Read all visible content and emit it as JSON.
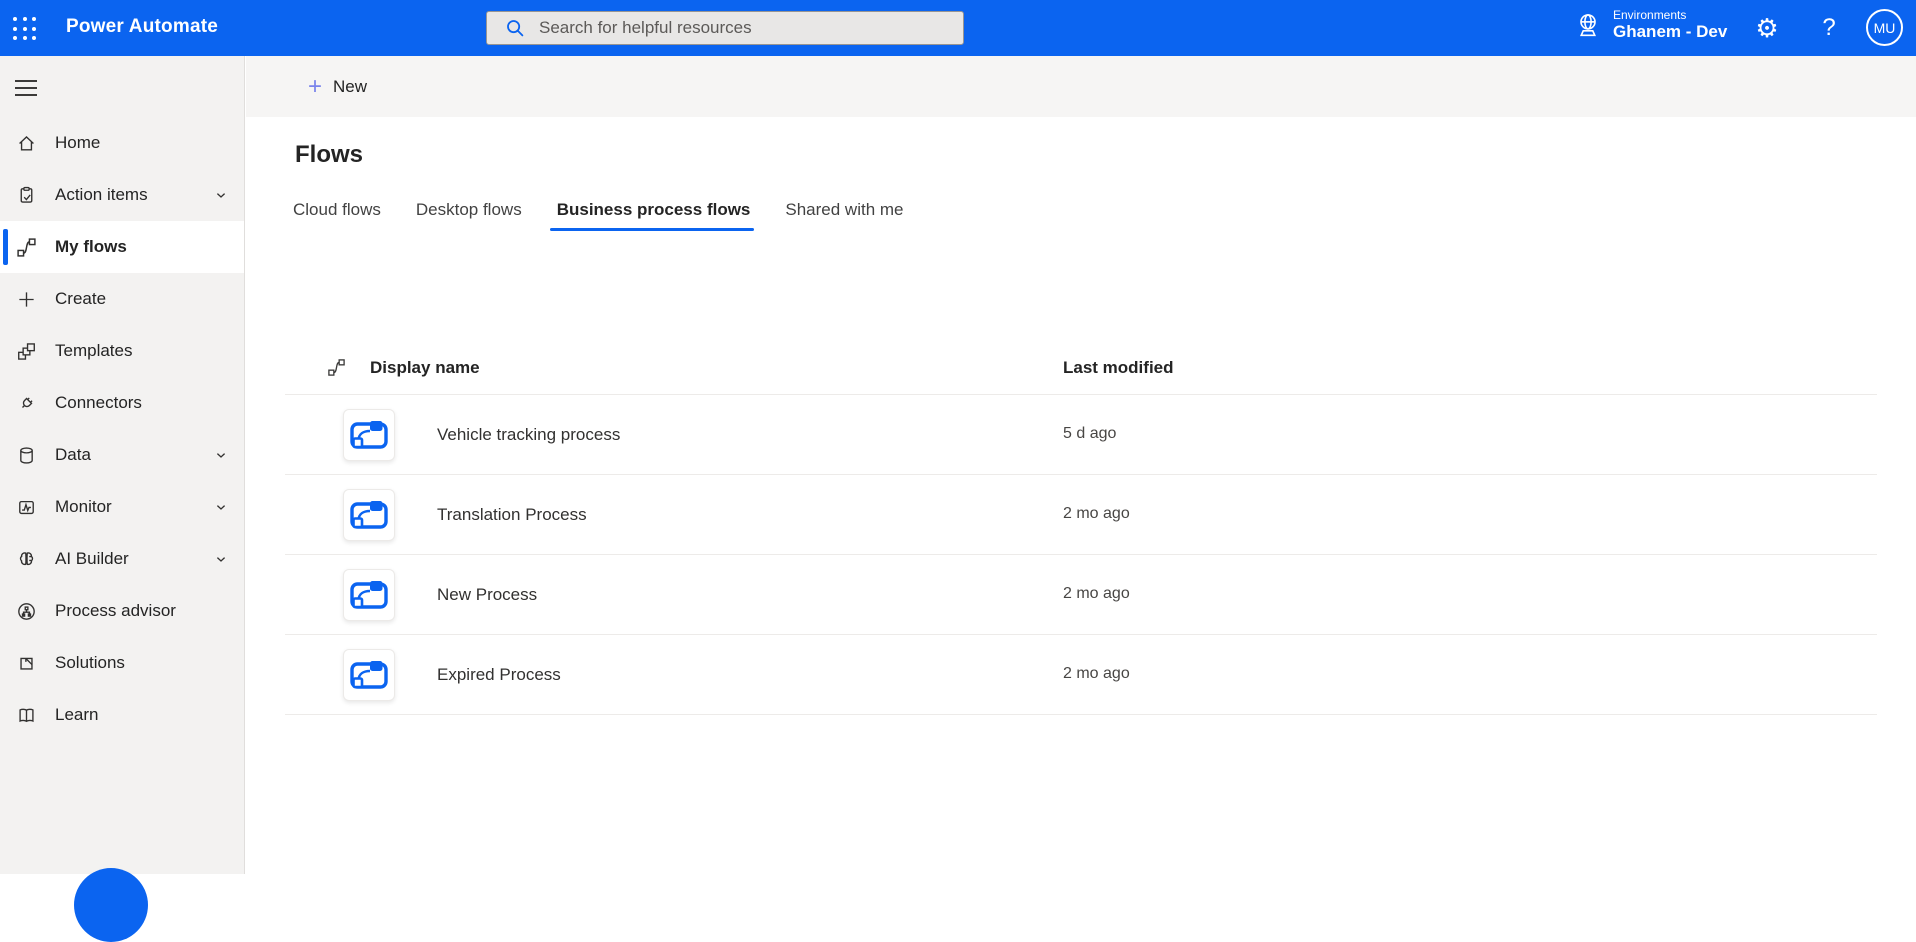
{
  "colors": {
    "accent": "#0B64F0",
    "header_bg": "#0B64F0",
    "sidebar_bg": "#F3F2F1"
  },
  "header": {
    "app_title": "Power Automate",
    "search_placeholder": "Search for helpful resources",
    "environments_label": "Environments",
    "environment_name": "Ghanem - Dev",
    "help_label": "?",
    "avatar_initials": "MU"
  },
  "command_bar": {
    "new_label": "New",
    "new_plus": "+"
  },
  "sidebar": {
    "items": [
      {
        "label": "Home",
        "icon": "home-icon"
      },
      {
        "label": "Action items",
        "icon": "action-items-icon",
        "chevron": true
      },
      {
        "label": "My flows",
        "icon": "my-flows-icon",
        "selected": true
      },
      {
        "label": "Create",
        "icon": "create-icon"
      },
      {
        "label": "Templates",
        "icon": "templates-icon"
      },
      {
        "label": "Connectors",
        "icon": "connectors-icon"
      },
      {
        "label": "Data",
        "icon": "data-icon",
        "chevron": true
      },
      {
        "label": "Monitor",
        "icon": "monitor-icon",
        "chevron": true
      },
      {
        "label": "AI Builder",
        "icon": "ai-builder-icon",
        "chevron": true
      },
      {
        "label": "Process advisor",
        "icon": "process-advisor-icon"
      },
      {
        "label": "Solutions",
        "icon": "solutions-icon"
      },
      {
        "label": "Learn",
        "icon": "learn-icon"
      }
    ]
  },
  "main": {
    "page_title": "Flows",
    "tabs": [
      {
        "label": "Cloud flows"
      },
      {
        "label": "Desktop flows"
      },
      {
        "label": "Business process flows",
        "selected": true
      },
      {
        "label": "Shared with me"
      }
    ],
    "table": {
      "columns": {
        "name": "Display name",
        "modified": "Last modified"
      },
      "rows": [
        {
          "name": "Vehicle tracking process",
          "modified": "5 d ago",
          "icon": "flow-icon"
        },
        {
          "name": "Translation Process",
          "modified": "2 mo ago",
          "icon": "flow-icon"
        },
        {
          "name": "New Process",
          "modified": "2 mo ago",
          "icon": "flow-icon"
        },
        {
          "name": "Expired Process",
          "modified": "2 mo ago",
          "icon": "flow-icon"
        }
      ]
    }
  }
}
